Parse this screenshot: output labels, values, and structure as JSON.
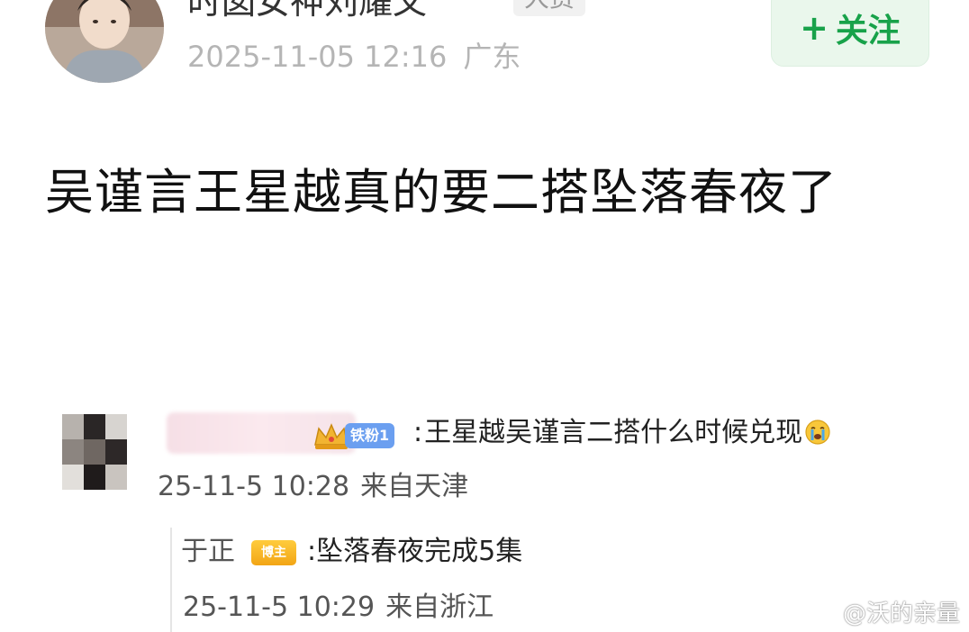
{
  "post": {
    "username": "时囡女神刘耀文",
    "role_badge": "大赏",
    "timestamp": "2025-11-05 12:16",
    "location": "广东",
    "follow_button": {
      "plus": "+",
      "label": "关注"
    },
    "text": "吴谨言王星越真的要二搭坠落春夜了"
  },
  "embed": {
    "comment": {
      "fan_badge": "铁粉1",
      "colon": ":",
      "text": "王星越吴谨言二搭什么时候兑现",
      "timestamp": "25-11-5 10:28",
      "from": "来自天津"
    },
    "reply": {
      "name": "于正",
      "badge": "博主",
      "colon": ":",
      "text": "坠落春夜完成5集",
      "timestamp": "25-11-5 10:29",
      "from": "来自浙江"
    }
  },
  "watermark": {
    "text": "@沃的亲量"
  },
  "colors": {
    "follow_text": "#18a24a",
    "follow_bg": "#eaf7ec",
    "meta_gray": "#b5b5b5",
    "fan_badge_bg": "#6b9ff0",
    "blogger_badge_bg": "#f2a515"
  }
}
